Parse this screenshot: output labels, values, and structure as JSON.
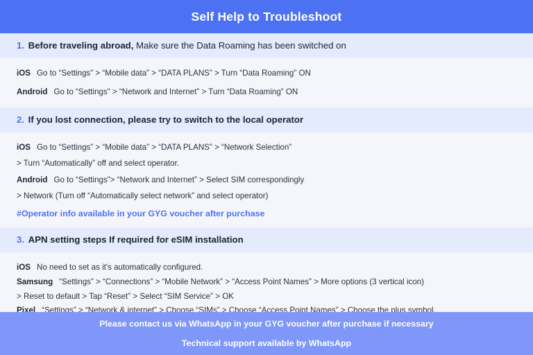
{
  "header": {
    "title": "Self Help to Troubleshoot",
    "bg_color": "#4c71f2",
    "text_color": "#ffffff"
  },
  "colors": {
    "accent_blue": "#4c71f2",
    "band_blue": "#e4ebfc",
    "page_bg": "#f5f6fc",
    "footer_blue": "#7f97f8",
    "body_text": "#2b3040"
  },
  "sections": [
    {
      "number": "1.",
      "heading_bold": "Before traveling abroad,",
      "heading_rest": " Make sure the Data Roaming has been switched on",
      "rows": [
        {
          "os": "iOS",
          "text": "Go to “Settings” > “Mobile data” > “DATA PLANS” > Turn “Data Roaming” ON"
        },
        {
          "os": "Android",
          "text": "Go to “Settings” > “Network and Internet” > Turn “Data Roaming” ON"
        }
      ]
    },
    {
      "number": "2.",
      "heading_bold": "If you lost connection, please try to switch to the local operator",
      "heading_rest": "",
      "rows": [
        {
          "os": "iOS",
          "text": "Go to “Settings” > “Mobile data” > “DATA PLANS” > “Network Selection”"
        },
        {
          "os": "",
          "text": "> Turn “Automatically” off and select operator."
        },
        {
          "os": "Android",
          "text": "Go to “Settings”>  “Network and Internet” > Select SIM correspondingly"
        },
        {
          "os": "",
          "text": "> Network (Turn off “Automatically select network” and select operator)"
        }
      ],
      "note": "#Operator info available in your GYG voucher after purchase"
    },
    {
      "number": "3.",
      "heading_bold": "APN setting steps If required for eSIM installation",
      "heading_rest": "",
      "rows": [
        {
          "os": "iOS",
          "text": "No need to set as it's automatically configured."
        },
        {
          "os": "Samsung",
          "text": "“Settings” > “Connections” > “Mobile Network” > “Access Point Names” > More options (3 vertical icon)"
        },
        {
          "os": "",
          "text": "> Reset to default > Tap “Reset” > Select “SIM Service” > OK"
        },
        {
          "os": "Pixel",
          "text": "“Settings” > “Network & internet” > Choose “SIMs” > Choose “Access Point Names” > Choose the plus symbol."
        }
      ]
    }
  ],
  "footer": {
    "line1": "Please contact us via WhatsApp  in your GYG voucher after purchase if necessary",
    "line2": "Technical support available by WhatsApp"
  }
}
